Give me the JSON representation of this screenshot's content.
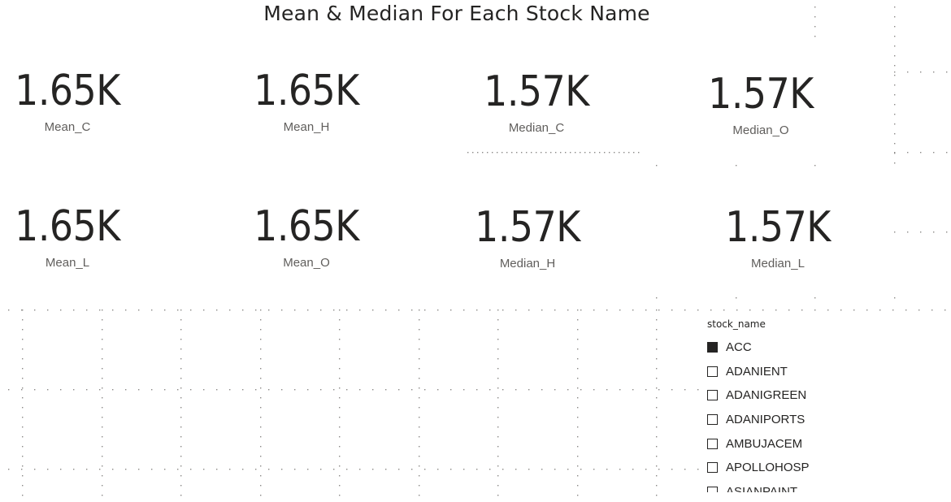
{
  "report": {
    "title": "Mean & Median For Each Stock Name"
  },
  "cards": [
    {
      "value": "1.65K",
      "label": "Mean_C"
    },
    {
      "value": "1.65K",
      "label": "Mean_H"
    },
    {
      "value": "1.57K",
      "label": "Median_C"
    },
    {
      "value": "1.57K",
      "label": "Median_O"
    },
    {
      "value": "1.65K",
      "label": "Mean_L"
    },
    {
      "value": "1.65K",
      "label": "Mean_O"
    },
    {
      "value": "1.57K",
      "label": "Median_H"
    },
    {
      "value": "1.57K",
      "label": "Median_L"
    }
  ],
  "slicer": {
    "header": "stock_name",
    "items": [
      {
        "label": "ACC",
        "checked": true
      },
      {
        "label": "ADANIENT",
        "checked": false
      },
      {
        "label": "ADANIGREEN",
        "checked": false
      },
      {
        "label": "ADANIPORTS",
        "checked": false
      },
      {
        "label": "AMBUJACEM",
        "checked": false
      },
      {
        "label": "APOLLOHOSP",
        "checked": false
      },
      {
        "label": "ASIANPAINT",
        "checked": false
      }
    ]
  }
}
